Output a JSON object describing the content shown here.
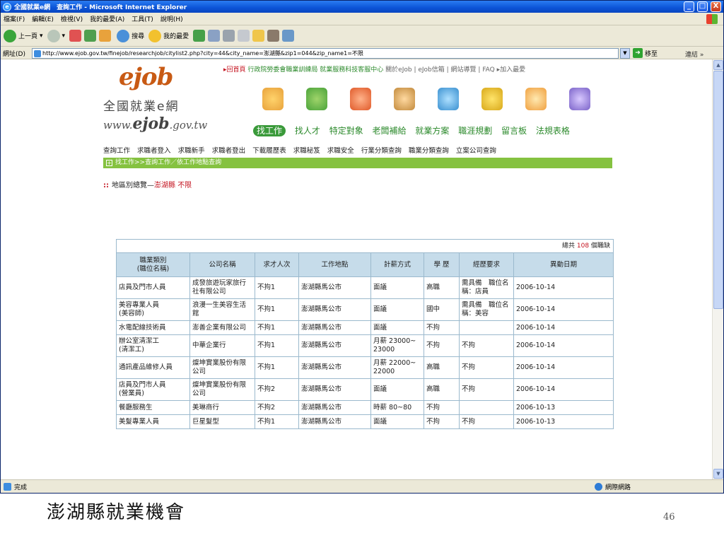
{
  "window": {
    "title": "全國就業e網　查詢工作 - Microsoft Internet Explorer",
    "min": "_",
    "max": "□",
    "close": "X"
  },
  "menu": [
    "檔案(F)",
    "編輯(E)",
    "檢視(V)",
    "我的最愛(A)",
    "工具(T)",
    "說明(H)"
  ],
  "toolbar": {
    "back": "上一頁",
    "search": "搜尋",
    "favorites": "我的最愛"
  },
  "address": {
    "label": "網址(D)",
    "url": "http://www.ejob.gov.tw/finejob/researchjob/citylist2.php?city=44&city_name=澎湖縣&zip1=044&zip_name1=不限",
    "go": "移至",
    "links": "連結 »"
  },
  "status": {
    "text": "完成",
    "zone": "網際網路"
  },
  "site": {
    "logo": "ejob",
    "logo_sub": "全國就業e網",
    "logo_url_pre": "www.",
    "logo_url_main": "ejob",
    "logo_url_post": ".gov.tw",
    "top_home": "▸回首頁",
    "top_org": "行政院勞委會職業訓練局 就業服務科技客服中心",
    "top_about": "關於eJob",
    "top_mail": "eJob信箱",
    "top_map": "網站導覽",
    "top_faq": "FAQ",
    "top_fav": "▸加入最愛",
    "main_nav": [
      "找工作",
      "找人才",
      "特定對象",
      "老闆補給",
      "就業方案",
      "職涯規劃",
      "留言板",
      "法規表格"
    ],
    "sub_nav": [
      "查詢工作",
      "求職者登入",
      "求職新手",
      "求職者登出",
      "下載履歷表",
      "求職秘笈",
      "求職安全",
      "行業分類查詢",
      "職業分類查詢",
      "立案公司查詢"
    ],
    "breadcrumb": "找工作>>查詢工作／依工作地點查詢",
    "breadcrumb_box": "+",
    "region_marker": "::",
    "region_label": "地區別總覽—",
    "region_city": "澎湖縣",
    "region_zip": "不限",
    "total_pre": "總共",
    "total_num": "108",
    "total_post": "個職缺",
    "headers": [
      "職業類別\n(職位名稱)",
      "公司名稱",
      "求才人次",
      "工作地點",
      "計薪方式",
      "學 歷",
      "經歷要求",
      "異動日期"
    ],
    "rows": [
      [
        "店員及門市人員",
        "成發旅遊玩家旅行社有限公司",
        "不拘1",
        "澎湖縣馬公市",
        "面議",
        "高職",
        "需具備　職位名稱：店員",
        "2006-10-14"
      ],
      [
        "美容專業人員\n(美容師)",
        "浪漫一生美容生活館",
        "不拘1",
        "澎湖縣馬公市",
        "面議",
        "國中",
        "需具備　職位名稱：美容",
        "2006-10-14"
      ],
      [
        "水電配線技術員",
        "澎善企業有限公司",
        "不拘1",
        "澎湖縣馬公市",
        "面議",
        "不拘",
        "",
        "2006-10-14"
      ],
      [
        "辦公室清潔工\n(清潔工)",
        "中華企業行",
        "不拘1",
        "澎湖縣馬公市",
        "月薪 23000~\n23000",
        "不拘",
        "不拘",
        "2006-10-14"
      ],
      [
        "通訊產品維修人員",
        "燦坤實業股份有限公司",
        "不拘1",
        "澎湖縣馬公市",
        "月薪 22000~\n22000",
        "高職",
        "不拘",
        "2006-10-14"
      ],
      [
        "店員及門市人員\n(營業員)",
        "燦坤實業股份有限公司",
        "不拘2",
        "澎湖縣馬公市",
        "面議",
        "高職",
        "不拘",
        "2006-10-14"
      ],
      [
        "餐廳服務生",
        "美琳商行",
        "不拘2",
        "澎湖縣馬公市",
        "時薪 80~80",
        "不拘",
        "",
        "2006-10-13"
      ],
      [
        "美髮專業人員",
        "巨星髮型",
        "不拘1",
        "澎湖縣馬公市",
        "面議",
        "不拘",
        "不拘",
        "2006-10-13"
      ]
    ]
  },
  "caption": "澎湖縣就業機會",
  "page_number": "46",
  "colors": {
    "xp_title": "#0b53d6",
    "site_green": "#85c240",
    "nav_green": "#2c8a2c",
    "header_blue": "#c6dcea",
    "accent_red": "#c4131f",
    "logo_orange": "#c85a14"
  }
}
